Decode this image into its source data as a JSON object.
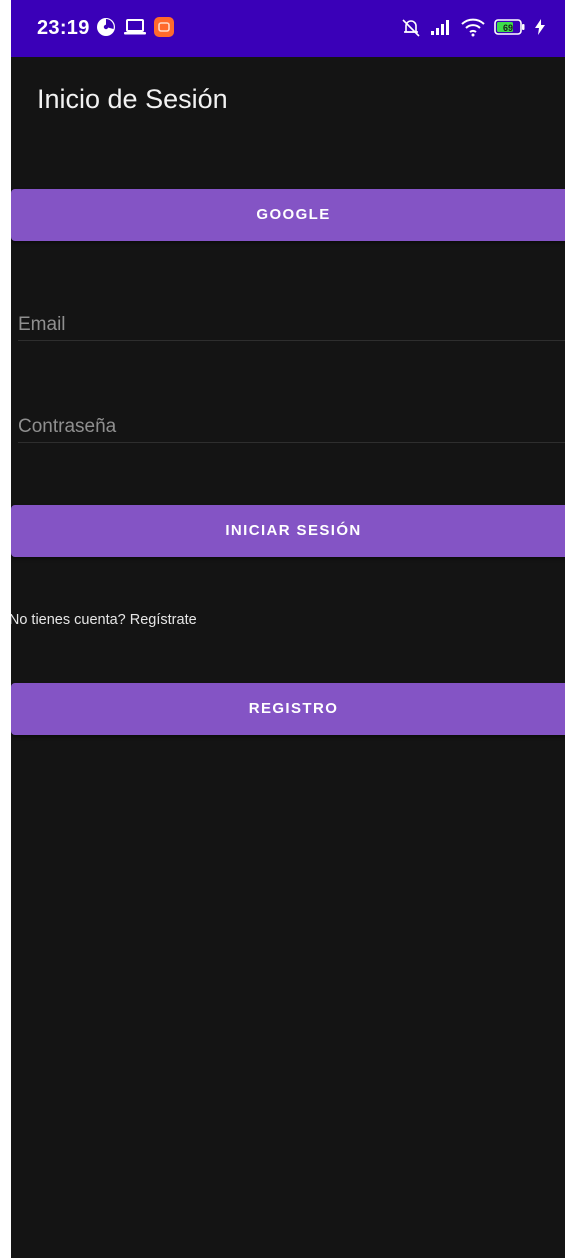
{
  "status_bar": {
    "time": "23:19",
    "battery_level": "69",
    "background_color": "#3a00b8",
    "left_icons": [
      "speed-gauge-icon",
      "laptop-icon",
      "app-notification-icon"
    ],
    "right_icons": [
      "notifications-muted-icon",
      "signal-icon",
      "wifi-icon",
      "battery-icon",
      "charging-icon"
    ]
  },
  "app_bar": {
    "title": "Inicio de Sesión"
  },
  "google_button": {
    "label": "GOOGLE"
  },
  "email_field": {
    "placeholder": "Email",
    "value": ""
  },
  "password_field": {
    "placeholder": "Contraseña",
    "value": ""
  },
  "login_button": {
    "label": "INICIAR SESIÓN"
  },
  "register_prompt": {
    "text": "¿No tienes cuenta? Regístrate"
  },
  "register_button": {
    "label": "REGISTRO"
  },
  "theme": {
    "background": "#141414",
    "button_color": "#8454c5",
    "text_color": "#ffffff"
  }
}
